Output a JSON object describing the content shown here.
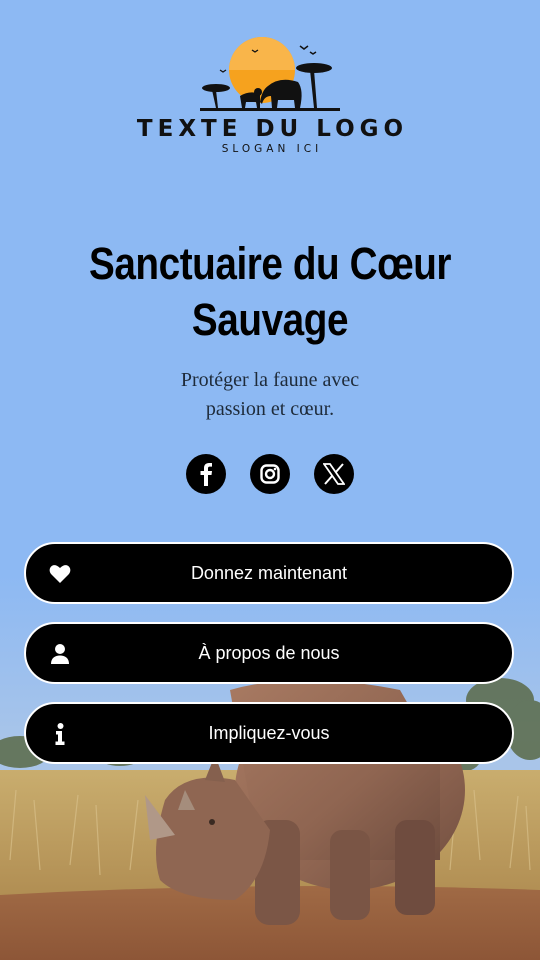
{
  "logo": {
    "text": "TEXTE DU LOGO",
    "slogan": "SLOGAN ICI"
  },
  "hero": {
    "title_line1": "Sanctuaire du Cœur",
    "title_line2": "Sauvage",
    "subtitle_line1": "Protéger la faune avec",
    "subtitle_line2": "passion et cœur."
  },
  "socials": [
    {
      "icon": "facebook-icon"
    },
    {
      "icon": "instagram-icon"
    },
    {
      "icon": "x-icon"
    }
  ],
  "buttons": [
    {
      "label": "Donnez maintenant",
      "icon": "heart-icon"
    },
    {
      "label": "À propos de nous",
      "icon": "user-icon"
    },
    {
      "label": "Impliquez-vous",
      "icon": "info-icon"
    }
  ],
  "colors": {
    "background": "#8db9f3",
    "button": "#000000",
    "sun": "#f6a21e"
  }
}
